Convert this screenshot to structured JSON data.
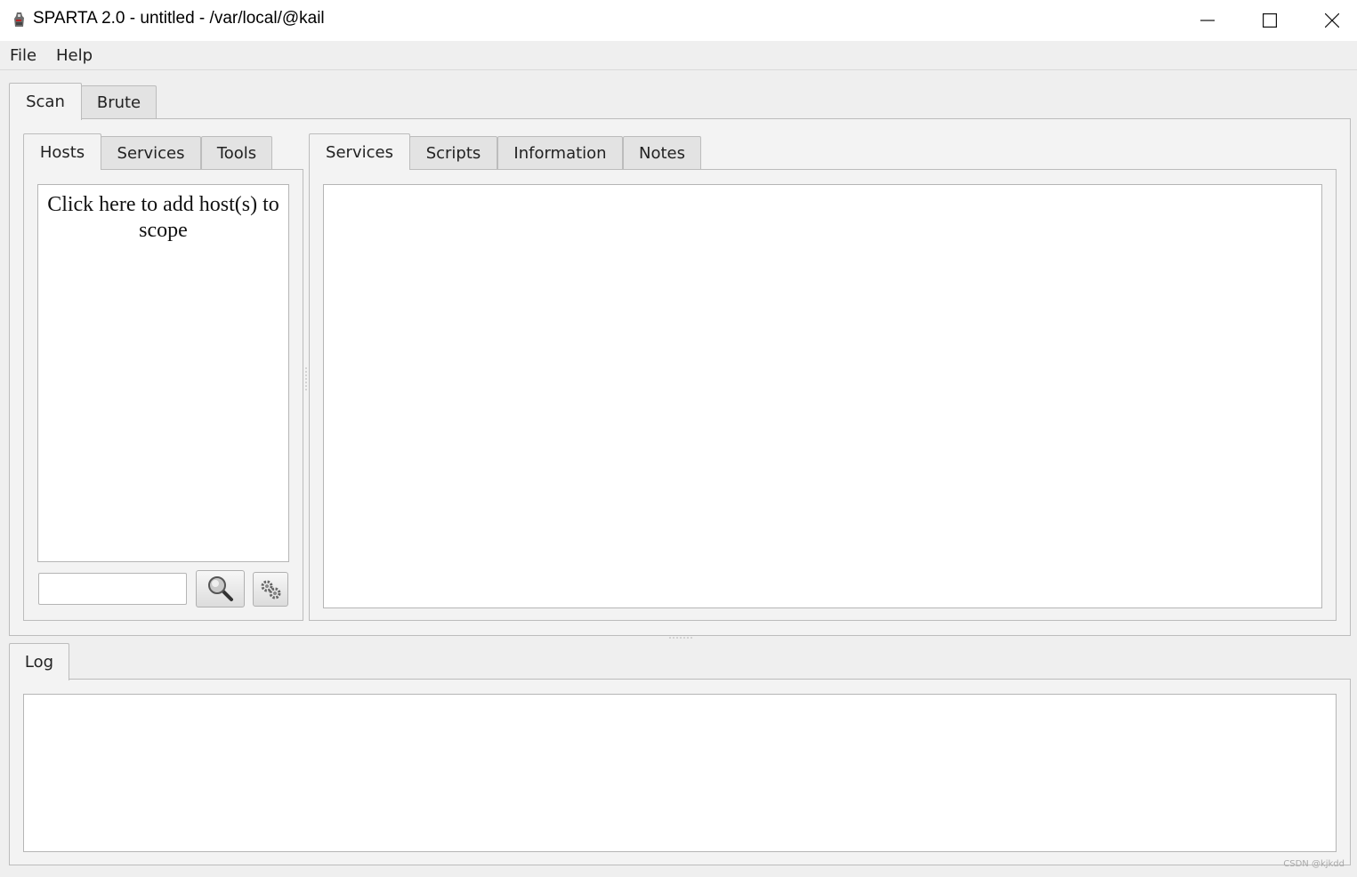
{
  "window": {
    "title": "SPARTA 2.0 - untitled - /var/local/@kail",
    "app_icon": "sparta-app-icon",
    "controls": [
      "minimize-icon",
      "maximize-icon",
      "close-icon"
    ]
  },
  "menubar": {
    "items": [
      "File",
      "Help"
    ]
  },
  "main_tabs": [
    "Scan",
    "Brute"
  ],
  "left_panel": {
    "tabs": [
      "Hosts",
      "Services",
      "Tools"
    ],
    "hosts_hint": "Click here to add host(s) to scope",
    "filter_input_value": "",
    "search_button_icon": "magnifier-icon",
    "settings_button_icon": "gears-icon"
  },
  "right_panel": {
    "tabs": [
      "Services",
      "Scripts",
      "Information",
      "Notes"
    ]
  },
  "bottom_panel": {
    "tabs": [
      "Log"
    ]
  },
  "watermark": "CSDN @kjkdd"
}
